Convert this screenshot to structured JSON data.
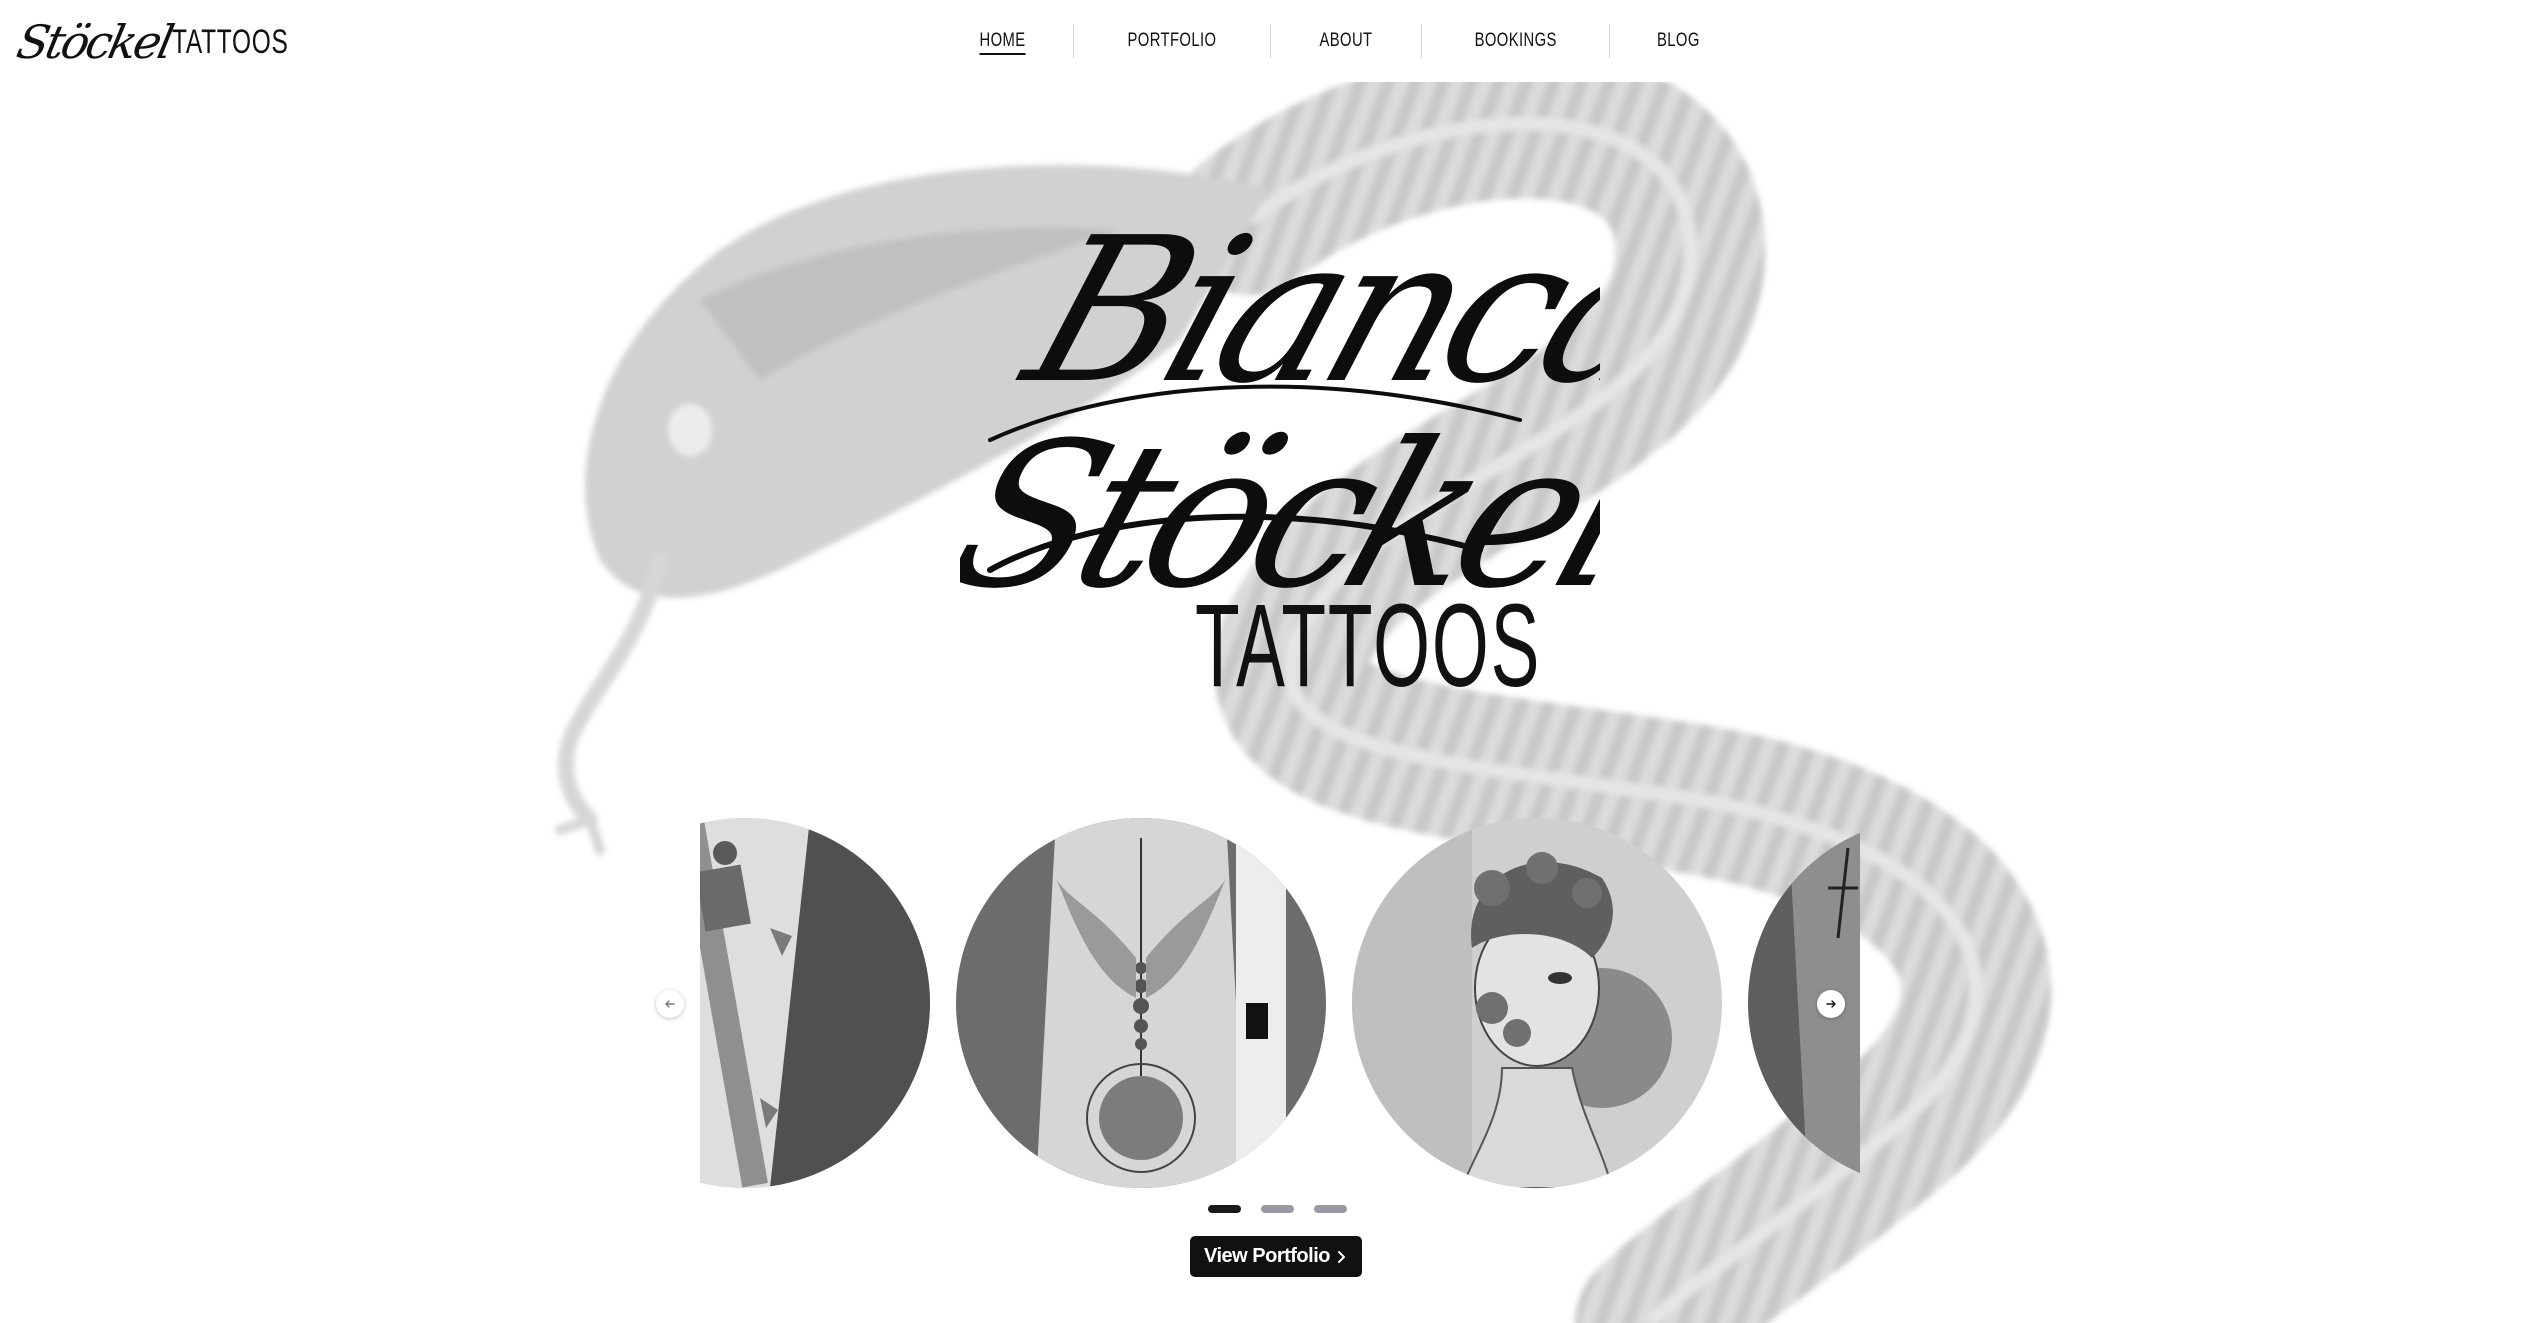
{
  "brand": {
    "script": "Stöckel",
    "word": "TATTOOS"
  },
  "nav": {
    "items": [
      {
        "label": "HOME",
        "active": true
      },
      {
        "label": "PORTFOLIO",
        "active": false
      },
      {
        "label": "ABOUT",
        "active": false
      },
      {
        "label": "BOOKINGS",
        "active": false
      },
      {
        "label": "BLOG",
        "active": false
      }
    ]
  },
  "hero": {
    "script_line1": "Bianca",
    "script_line2": "Stöckel",
    "word": "TATTOOS"
  },
  "carousel": {
    "slides": [
      {
        "subject": "dagger and ivy forearm tattoo"
      },
      {
        "subject": "winged moon phase forearm tattoo"
      },
      {
        "subject": "woman with floral face tattoo"
      },
      {
        "subject": "line art arm tattoo"
      }
    ],
    "prev_icon": "arrow-left-icon",
    "next_icon": "arrow-right-icon",
    "pagination": {
      "count": 3,
      "active": 1
    }
  },
  "cta": {
    "label": "View Portfolio",
    "icon": "chevron-right-icon"
  },
  "colors": {
    "text": "#111111",
    "dot_inactive": "#9a98a2",
    "dot_active": "#1a1a1a",
    "snake": "#d2d2d2"
  }
}
